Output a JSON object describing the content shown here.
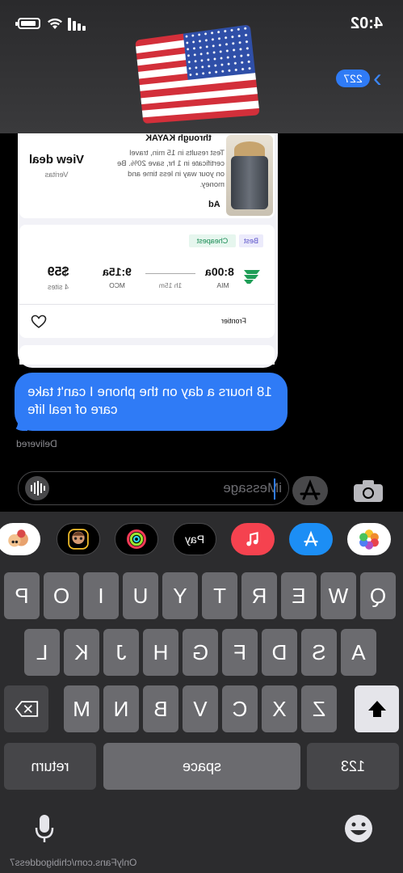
{
  "status_bar": {
    "time": "4:02"
  },
  "header": {
    "unread_count": "227"
  },
  "ad_card": {
    "title": "through KAYAK",
    "body": "Test results in 15 min, travel certificate in 1 hr, save 20%. Be on your way in less time and money.",
    "ad_label": "Ad",
    "cta": "View deal",
    "advertiser": "Veritas"
  },
  "flight_card": {
    "badge_best": "Best",
    "badge_cheapest": "Cheapest",
    "depart_time": "8:00a",
    "depart_code": "MIA",
    "duration": "1h 15m",
    "arrive_time": "9:15a",
    "arrive_code": "MCO",
    "price": "$59",
    "sites": "4 sites",
    "carrier": "Frontier"
  },
  "message": {
    "text": "18 hours a day on the phone I can't take care of real life",
    "status": "Delivered"
  },
  "input": {
    "placeholder": "iMessage"
  },
  "app_drawer": [
    "Photos",
    "App Store",
    "Music",
    "Apple Pay",
    "Activity",
    "Memoji",
    "Memoji Stickers"
  ],
  "keyboard": {
    "row1": [
      "Q",
      "W",
      "E",
      "R",
      "T",
      "Y",
      "U",
      "I",
      "O",
      "P"
    ],
    "row2": [
      "A",
      "S",
      "D",
      "F",
      "G",
      "H",
      "J",
      "K",
      "L"
    ],
    "row3": [
      "Z",
      "X",
      "C",
      "V",
      "B",
      "N",
      "M"
    ],
    "numbers": "123",
    "space": "space",
    "return": "return"
  },
  "watermark": "OnlyFans.com/chibigoddess7"
}
